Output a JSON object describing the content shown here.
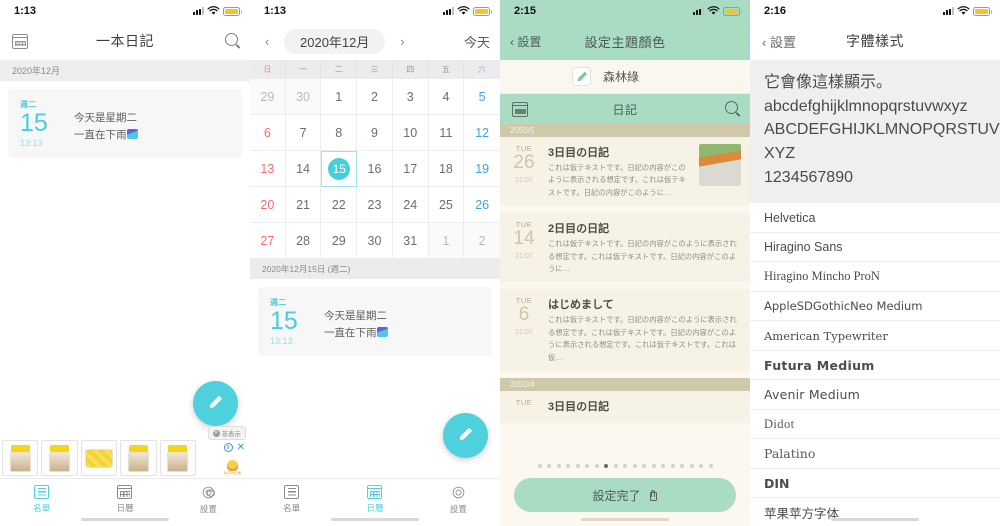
{
  "panels": {
    "diary_list": {
      "status": {
        "time": "1:13"
      },
      "nav": {
        "calendar_icon": "calendar-icon",
        "title": "一本日記",
        "search_icon": "search-icon"
      },
      "month_label": "2020年12月",
      "entry": {
        "dow": "週二",
        "day": "15",
        "time": "13:13",
        "line1": "今天是星期二",
        "line2": "一直在下雨"
      },
      "fab": "compose-fab",
      "ad": {
        "hide_label": "非表示",
        "info": "ⓘ",
        "close": "✕",
        "logo_caption": "ねずみ企画"
      },
      "tabs": [
        {
          "label": "名單",
          "icon": "list-icon",
          "active": true
        },
        {
          "label": "日曆",
          "icon": "calendar-icon",
          "active": false
        },
        {
          "label": "設置",
          "icon": "gear-icon",
          "active": false
        }
      ]
    },
    "calendar": {
      "status": {
        "time": "1:13"
      },
      "header": {
        "prev": "‹",
        "month": "2020年12月",
        "next": "›",
        "today": "今天"
      },
      "weekdays": [
        "日",
        "一",
        "二",
        "三",
        "四",
        "五",
        "六"
      ],
      "days": [
        {
          "n": "29",
          "t": "out"
        },
        {
          "n": "30",
          "t": "out"
        },
        {
          "n": "1",
          "t": ""
        },
        {
          "n": "2",
          "t": ""
        },
        {
          "n": "3",
          "t": ""
        },
        {
          "n": "4",
          "t": ""
        },
        {
          "n": "5",
          "t": "sat"
        },
        {
          "n": "6",
          "t": "sun"
        },
        {
          "n": "7",
          "t": ""
        },
        {
          "n": "8",
          "t": ""
        },
        {
          "n": "9",
          "t": ""
        },
        {
          "n": "10",
          "t": ""
        },
        {
          "n": "11",
          "t": ""
        },
        {
          "n": "12",
          "t": "sat"
        },
        {
          "n": "13",
          "t": "sun"
        },
        {
          "n": "14",
          "t": ""
        },
        {
          "n": "15",
          "t": "sel"
        },
        {
          "n": "16",
          "t": ""
        },
        {
          "n": "17",
          "t": ""
        },
        {
          "n": "18",
          "t": ""
        },
        {
          "n": "19",
          "t": "sat"
        },
        {
          "n": "20",
          "t": "sun"
        },
        {
          "n": "21",
          "t": ""
        },
        {
          "n": "22",
          "t": ""
        },
        {
          "n": "23",
          "t": ""
        },
        {
          "n": "24",
          "t": ""
        },
        {
          "n": "25",
          "t": ""
        },
        {
          "n": "26",
          "t": "sat"
        },
        {
          "n": "27",
          "t": "sun"
        },
        {
          "n": "28",
          "t": ""
        },
        {
          "n": "29",
          "t": ""
        },
        {
          "n": "30",
          "t": ""
        },
        {
          "n": "31",
          "t": ""
        },
        {
          "n": "1",
          "t": "out"
        },
        {
          "n": "2",
          "t": "out"
        }
      ],
      "selected_label": "2020年12月15日 (週二)",
      "entry": {
        "dow": "週二",
        "day": "15",
        "time": "13:13",
        "line1": "今天是星期二",
        "line2": "一直在下雨"
      },
      "fab": "compose-fab",
      "tabs": [
        {
          "label": "名單",
          "icon": "list-icon",
          "active": false
        },
        {
          "label": "日曆",
          "icon": "calendar-icon",
          "active": true
        },
        {
          "label": "設置",
          "icon": "gear-icon",
          "active": false
        }
      ]
    },
    "theme_color": {
      "status": {
        "time": "2:15"
      },
      "nav": {
        "back": "‹ 設置",
        "title": "設定主題顏色"
      },
      "theme": {
        "swatch_icon": "pencil-swatch-icon",
        "name": "森林綠"
      },
      "preview_nav": {
        "calendar_icon": "calendar-icon",
        "title": "日記",
        "search_icon": "search-icon"
      },
      "groups": [
        {
          "ym": "2050/5",
          "entries": [
            {
              "dow": "TUE",
              "day": "26",
              "time": "21:07",
              "title": "3日目の日記",
              "text": "これは仮テキストです。日記の内容がこのように表示される想定です。これは仮テキストです。日記の内容がこのように…",
              "thumb": "playground-photo"
            },
            {
              "dow": "TUE",
              "day": "14",
              "time": "21:07",
              "title": "2日目の日記",
              "text": "これは仮テキストです。日記の内容がこのように表示される想定です。これは仮テキストです。日記の内容がこのように…",
              "thumb": ""
            },
            {
              "dow": "TUE",
              "day": "6",
              "time": "21:07",
              "title": "はじめまして",
              "text": "これは仮テキストです。日記の内容がこのように表示される想定です。これは仮テキストです。日記の内容がこのように表示される想定です。これは仮テキストです。これは仮…",
              "thumb": ""
            }
          ]
        },
        {
          "ym": "2050/4",
          "entries": [
            {
              "dow": "TUE",
              "day": "",
              "time": "",
              "title": "3日目の日記",
              "text": "",
              "thumb": ""
            }
          ]
        }
      ],
      "dots": {
        "count": 19,
        "active_index": 7
      },
      "confirm": {
        "label": "設定完了",
        "icon": "lock-icon"
      }
    },
    "font_style": {
      "status": {
        "time": "2:16"
      },
      "nav": {
        "back": "‹ 設置",
        "title": "字體樣式"
      },
      "sample": [
        "它會像這樣顯示。",
        "abcdefghijklmnopqrstuvwxyz",
        "ABCDEFGHIJKLMNOPQRSTUVW",
        "XYZ",
        "1234567890"
      ],
      "fonts": [
        "Helvetica",
        "Hiragino Sans",
        "Hiragino Mincho ProN",
        "AppleSDGothicNeo Medium",
        "American Typewriter",
        "Futura Medium",
        "Avenir Medium",
        "Didot",
        "Palatino",
        "DIN",
        "苹果苹方字体"
      ]
    }
  },
  "colors": {
    "teal": "#4ed0dd",
    "green": "#a9dcc3",
    "cream": "#faf8ef",
    "sunday": "#f07070",
    "saturday": "#3ea1ef"
  }
}
